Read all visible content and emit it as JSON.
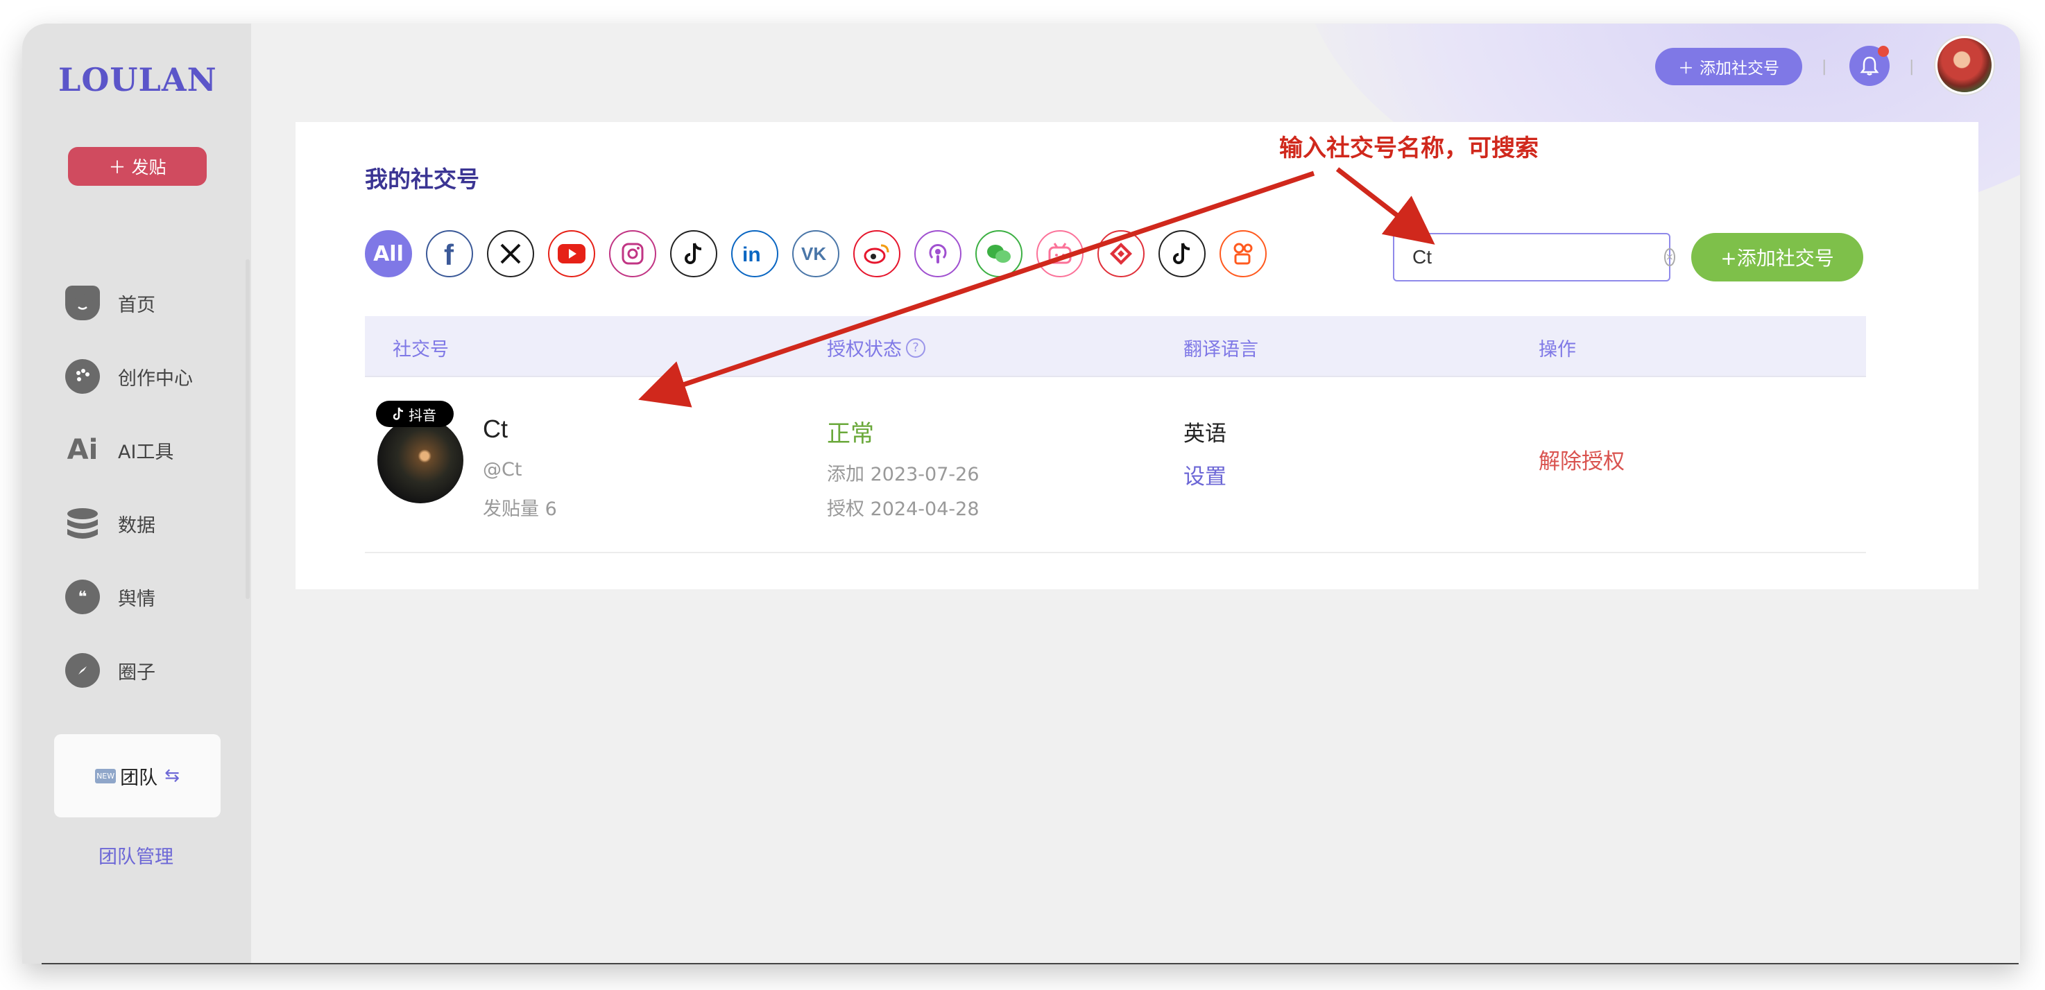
{
  "sidebar": {
    "logo": "LOULAN",
    "post_button": "发贴",
    "nav": [
      {
        "label": "首页",
        "icon": "home-icon"
      },
      {
        "label": "创作中心",
        "icon": "palette-icon"
      },
      {
        "label": "AI工具",
        "icon": "ai-icon"
      },
      {
        "label": "数据",
        "icon": "database-icon"
      },
      {
        "label": "舆情",
        "icon": "quote-icon"
      },
      {
        "label": "圈子",
        "icon": "compass-icon"
      }
    ],
    "team_badge": "NEW",
    "team_label": "团队",
    "team_manage": "团队管理"
  },
  "topbar": {
    "add_social": "添加社交号"
  },
  "main": {
    "title": "我的社交号",
    "platforms": [
      {
        "name": "all",
        "label": "All"
      },
      {
        "name": "facebook"
      },
      {
        "name": "x"
      },
      {
        "name": "youtube"
      },
      {
        "name": "instagram"
      },
      {
        "name": "tiktok"
      },
      {
        "name": "linkedin"
      },
      {
        "name": "vk"
      },
      {
        "name": "weibo"
      },
      {
        "name": "podcasts"
      },
      {
        "name": "wechat"
      },
      {
        "name": "bilibili"
      },
      {
        "name": "xigua"
      },
      {
        "name": "douyin"
      },
      {
        "name": "kuaishou"
      }
    ],
    "search": {
      "value": "Ct",
      "placeholder": ""
    },
    "add_button": "+添加社交号",
    "table": {
      "headers": [
        "社交号",
        "授权状态",
        "翻译语言",
        "操作"
      ],
      "rows": [
        {
          "platform_badge": "抖音",
          "name": "Ct",
          "handle": "@Ct",
          "posts": "发贴量 6",
          "status": "正常",
          "added": "添加 2023-07-26",
          "authorized": "授权 2024-04-28",
          "language": "英语",
          "language_action": "设置",
          "action": "解除授权"
        }
      ]
    }
  },
  "annotation": "输入社交号名称，可搜索",
  "colors": {
    "accent": "#7f78e6",
    "post_button": "#d04b5f",
    "add_green": "#7ec04a",
    "status_ok": "#6aa83a",
    "danger": "#d9534f",
    "annotation": "#d0281c"
  }
}
